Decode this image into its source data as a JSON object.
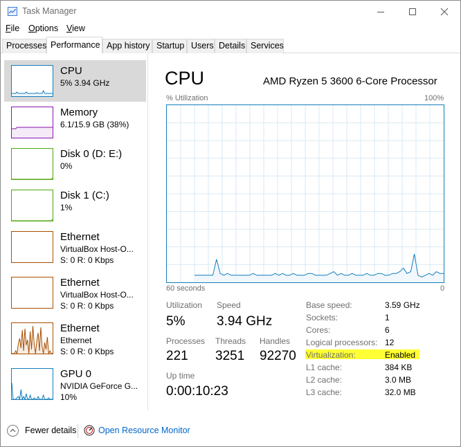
{
  "window": {
    "title": "Task Manager"
  },
  "menu": [
    {
      "label": "File",
      "key": "F",
      "rest": "ile"
    },
    {
      "label": "Options",
      "key": "O",
      "rest": "ptions"
    },
    {
      "label": "View",
      "key": "V",
      "rest": "iew"
    }
  ],
  "tabs": [
    "Processes",
    "Performance",
    "App history",
    "Startup",
    "Users",
    "Details",
    "Services"
  ],
  "active_tab": "Performance",
  "resources": [
    {
      "name": "CPU",
      "sub1": "5%  3.94 GHz",
      "sub2": "",
      "color": "#117dbb",
      "selected": true
    },
    {
      "name": "Memory",
      "sub1": "6.1/15.9 GB (38%)",
      "sub2": "",
      "color": "#8b12ae",
      "selected": false
    },
    {
      "name": "Disk 0 (D: E:)",
      "sub1": "0%",
      "sub2": "",
      "color": "#4da60c",
      "selected": false
    },
    {
      "name": "Disk 1 (C:)",
      "sub1": "1%",
      "sub2": "",
      "color": "#4da60c",
      "selected": false
    },
    {
      "name": "Ethernet",
      "sub1": "VirtualBox Host-O...",
      "sub2": "S: 0 R: 0 Kbps",
      "color": "#a74f01",
      "selected": false
    },
    {
      "name": "Ethernet",
      "sub1": "VirtualBox Host-O...",
      "sub2": "S: 0 R: 0 Kbps",
      "color": "#a74f01",
      "selected": false
    },
    {
      "name": "Ethernet",
      "sub1": "Ethernet",
      "sub2": "S: 0 R: 0 Kbps",
      "color": "#a74f01",
      "selected": false
    },
    {
      "name": "GPU 0",
      "sub1": "NVIDIA GeForce G...",
      "sub2": "10%",
      "color": "#117dbb",
      "selected": false
    }
  ],
  "detail": {
    "title": "CPU",
    "model": "AMD Ryzen 5 3600 6-Core Processor",
    "graph": {
      "ylabel": "% Utilization",
      "ymax_label": "100%",
      "xlabel": "60 seconds",
      "xmin_label": "0",
      "utilization_history_percent": [
        4,
        4,
        4,
        4,
        4,
        4,
        13,
        5,
        4,
        5,
        4,
        4,
        4,
        4,
        4,
        4,
        5,
        4,
        4,
        4,
        4,
        4,
        5,
        4,
        5,
        4,
        4,
        5,
        4,
        4,
        4,
        5,
        5,
        4,
        4,
        4,
        4,
        5,
        6,
        4,
        5,
        4,
        4,
        5,
        4,
        4,
        4,
        5,
        4,
        4,
        5,
        5,
        4,
        4,
        5,
        5,
        6,
        8,
        5,
        6,
        16,
        4,
        3,
        4,
        5,
        4,
        6,
        5,
        5
      ]
    },
    "stats": {
      "utilization_label": "Utilization",
      "utilization_value": "5%",
      "speed_label": "Speed",
      "speed_value": "3.94 GHz",
      "processes_label": "Processes",
      "processes_value": "221",
      "threads_label": "Threads",
      "threads_value": "3251",
      "handles_label": "Handles",
      "handles_value": "92270",
      "uptime_label": "Up time",
      "uptime_value": "0:00:10:23"
    },
    "info": [
      {
        "label": "Base speed:",
        "value": "3.59 GHz"
      },
      {
        "label": "Sockets:",
        "value": "1"
      },
      {
        "label": "Cores:",
        "value": "6"
      },
      {
        "label": "Logical processors:",
        "value": "12"
      },
      {
        "label": "Virtualization:",
        "value": "Enabled"
      },
      {
        "label": "L1 cache:",
        "value": "384 KB"
      },
      {
        "label": "L2 cache:",
        "value": "3.0 MB"
      },
      {
        "label": "L3 cache:",
        "value": "32.0 MB"
      }
    ],
    "highlight_color": "#ffff33"
  },
  "footer": {
    "fewer_details": "Fewer details",
    "open_resource_monitor": "Open Resource Monitor"
  }
}
